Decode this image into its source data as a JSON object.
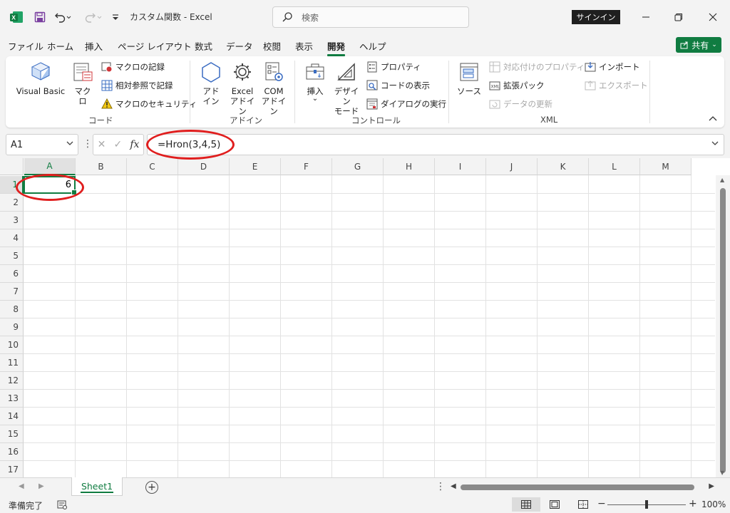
{
  "titlebar": {
    "title": "カスタム関数  -  Excel",
    "search_placeholder": "検索",
    "signin": "サインイン"
  },
  "tabs": [
    "ファイル",
    "ホーム",
    "挿入",
    "ページ レイアウト",
    "数式",
    "データ",
    "校閲",
    "表示",
    "開発",
    "ヘルプ"
  ],
  "active_tab": "開発",
  "share_label": "共有",
  "ribbon": {
    "code": {
      "label": "コード",
      "visual_basic": "Visual Basic",
      "macro": "マクロ",
      "record_macro": "マクロの記録",
      "relative_ref": "相対参照で記録",
      "macro_security": "マクロのセキュリティ"
    },
    "addins": {
      "label": "アドイン",
      "addin_l1": "アド",
      "addin_l2": "イン",
      "excel_addin_l1": "Excel",
      "excel_addin_l2": "アドイン",
      "com_addin_l1": "COM",
      "com_addin_l2": "アドイン"
    },
    "controls": {
      "label": "コントロール",
      "insert": "挿入",
      "insert_arrow": "⌄",
      "design_l1": "デザイン",
      "design_l2": "モード",
      "properties": "プロパティ",
      "view_code": "コードの表示",
      "run_dialog": "ダイアログの実行"
    },
    "xml": {
      "label": "XML",
      "source": "ソース",
      "map_properties": "対応付けのプロパティ",
      "expansion_packs": "拡張パック",
      "refresh_data": "データの更新",
      "import": "インポート",
      "export": "エクスポート"
    }
  },
  "formula_bar": {
    "name_box": "A1",
    "formula": "=Hron(3,4,5)"
  },
  "columns": [
    "A",
    "B",
    "C",
    "D",
    "E",
    "F",
    "G",
    "H",
    "I",
    "J",
    "K",
    "L",
    "M"
  ],
  "rows": [
    "1",
    "2",
    "3",
    "4",
    "5",
    "6",
    "7",
    "8",
    "9",
    "10",
    "11",
    "12",
    "13",
    "14",
    "15",
    "16",
    "17"
  ],
  "cells": {
    "A1": "6"
  },
  "sheet": {
    "name": "Sheet1"
  },
  "status": {
    "ready": "準備完了",
    "zoom": "100%"
  },
  "colors": {
    "accent": "#107c41",
    "annotation": "#e01e1e"
  }
}
